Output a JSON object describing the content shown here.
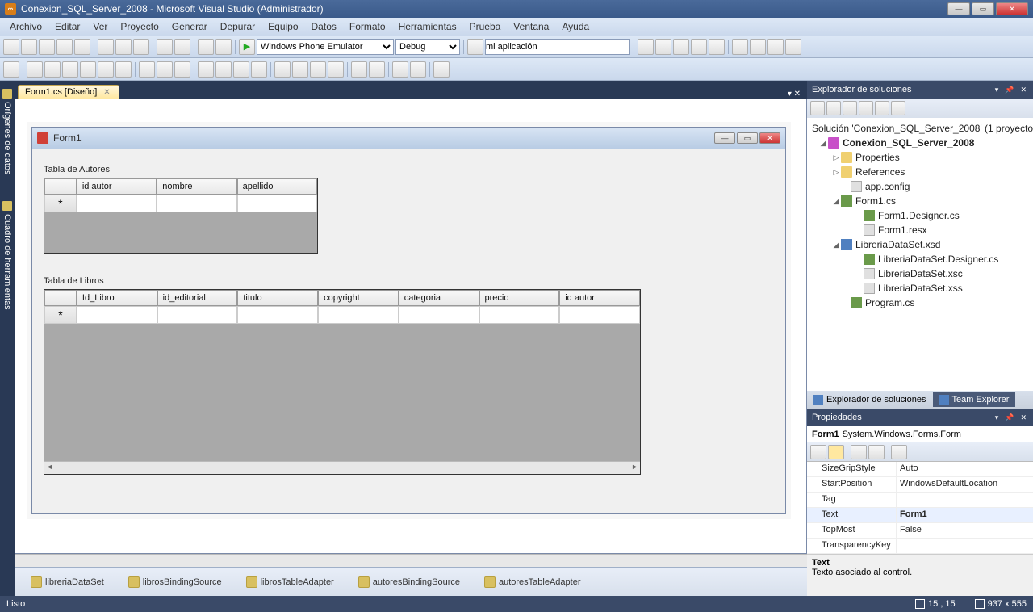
{
  "title": "Conexion_SQL_Server_2008 - Microsoft Visual Studio (Administrador)",
  "menu": [
    "Archivo",
    "Editar",
    "Ver",
    "Proyecto",
    "Generar",
    "Depurar",
    "Equipo",
    "Datos",
    "Formato",
    "Herramientas",
    "Prueba",
    "Ventana",
    "Ayuda"
  ],
  "toolbar": {
    "platform": "Windows Phone Emulator",
    "config": "Debug",
    "search": "mi aplicación"
  },
  "left_rail": [
    "Orígenes de datos",
    "Cuadro de herramientas"
  ],
  "doc_tab": "Form1.cs [Diseño]",
  "form": {
    "title": "Form1",
    "table1_label": "Tabla de Autores",
    "table1_cols": [
      "id autor",
      "nombre",
      "apellido"
    ],
    "table2_label": "Tabla de Libros",
    "table2_cols": [
      "Id_Libro",
      "id_editorial",
      "titulo",
      "copyright",
      "categoria",
      "precio",
      "id autor"
    ]
  },
  "components": [
    "libreriaDataSet",
    "librosBindingSource",
    "librosTableAdapter",
    "autoresBindingSource",
    "autoresTableAdapter"
  ],
  "solution_explorer": {
    "title": "Explorador de soluciones",
    "root": "Solución 'Conexion_SQL_Server_2008' (1 proyecto)",
    "project": "Conexion_SQL_Server_2008",
    "nodes": {
      "properties": "Properties",
      "references": "References",
      "appconfig": "app.config",
      "form1": "Form1.cs",
      "form1d": "Form1.Designer.cs",
      "form1r": "Form1.resx",
      "dataset": "LibreriaDataSet.xsd",
      "dsd": "LibreriaDataSet.Designer.cs",
      "dsxc": "LibreriaDataSet.xsc",
      "dsxss": "LibreriaDataSet.xss",
      "program": "Program.cs"
    }
  },
  "right_tabs": {
    "sol": "Explorador de soluciones",
    "team": "Team Explorer"
  },
  "properties": {
    "title": "Propiedades",
    "target_name": "Form1",
    "target_type": "System.Windows.Forms.Form",
    "rows": [
      {
        "name": "SizeGripStyle",
        "value": "Auto"
      },
      {
        "name": "StartPosition",
        "value": "WindowsDefaultLocation"
      },
      {
        "name": "Tag",
        "value": ""
      },
      {
        "name": "Text",
        "value": "Form1",
        "bold": true,
        "sel": true
      },
      {
        "name": "TopMost",
        "value": "False"
      },
      {
        "name": "TransparencyKey",
        "value": ""
      }
    ],
    "desc_title": "Text",
    "desc_text": "Texto asociado al control."
  },
  "status": {
    "ready": "Listo",
    "pos": "15 , 15",
    "size": "937 x 555"
  }
}
